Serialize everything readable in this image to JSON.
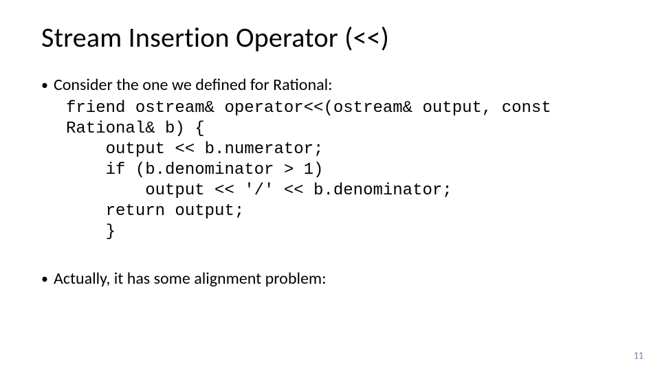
{
  "title": "Stream Insertion Operator (<<)",
  "bullet1": "Consider the one we defined for Rational:",
  "code": {
    "l1": "friend ostream& operator<<(ostream& output, const",
    "l2": "Rational& b) {",
    "l3": "    output << b.numerator;",
    "l4": "    if (b.denominator > 1)",
    "l5": "        output << '/' << b.denominator;",
    "l6": "    return output;",
    "l7": "    }"
  },
  "bullet2": "Actually, it has some alignment problem:",
  "page_number": "11"
}
